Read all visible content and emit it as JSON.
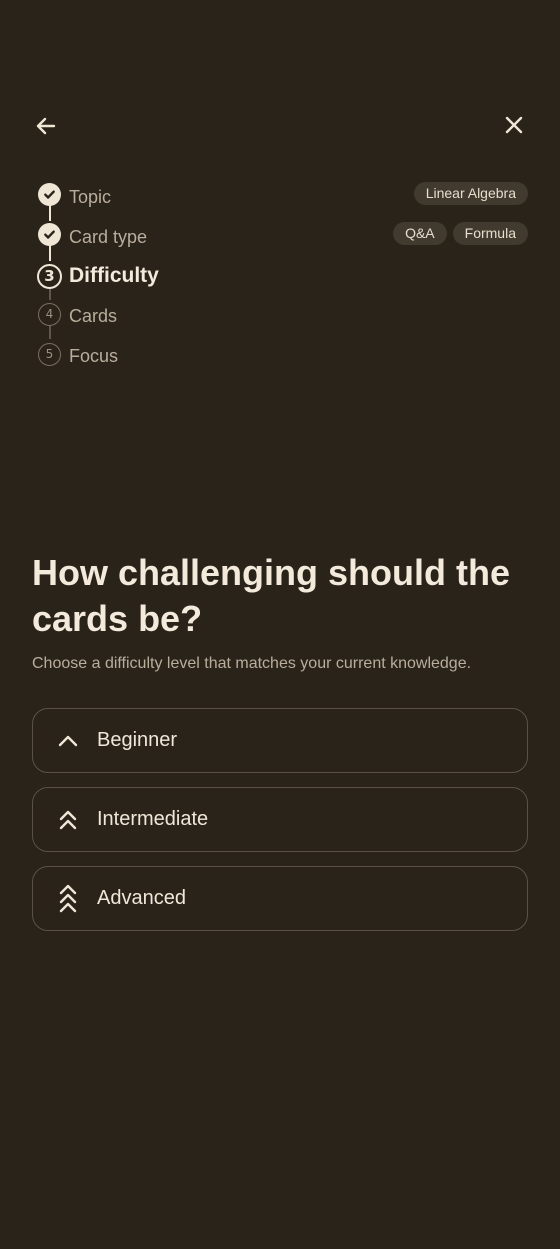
{
  "nav": {
    "back_icon": "arrow-left-icon",
    "close_icon": "close-icon"
  },
  "stepper": {
    "steps": [
      {
        "number": "1",
        "label": "Topic",
        "state": "done",
        "chips": [
          "Linear Algebra"
        ]
      },
      {
        "number": "2",
        "label": "Card type",
        "state": "done",
        "chips": [
          "Q&A",
          "Formula"
        ]
      },
      {
        "number": "3",
        "label": "Difficulty",
        "state": "current",
        "chips": []
      },
      {
        "number": "4",
        "label": "Cards",
        "state": "pending",
        "chips": []
      },
      {
        "number": "5",
        "label": "Focus",
        "state": "pending",
        "chips": []
      }
    ]
  },
  "main": {
    "question": "How challenging should the cards be?",
    "subtitle": "Choose a difficulty level that matches your current knowledge.",
    "options": [
      {
        "label": "Beginner",
        "icon": "chevron-up-icon"
      },
      {
        "label": "Intermediate",
        "icon": "double-chevron-up-icon"
      },
      {
        "label": "Advanced",
        "icon": "triple-chevron-up-icon"
      }
    ]
  },
  "colors": {
    "background": "#29231a",
    "text": "#efe6d6",
    "chip_bg": "#413a2f",
    "option_border": "#5a5246"
  }
}
